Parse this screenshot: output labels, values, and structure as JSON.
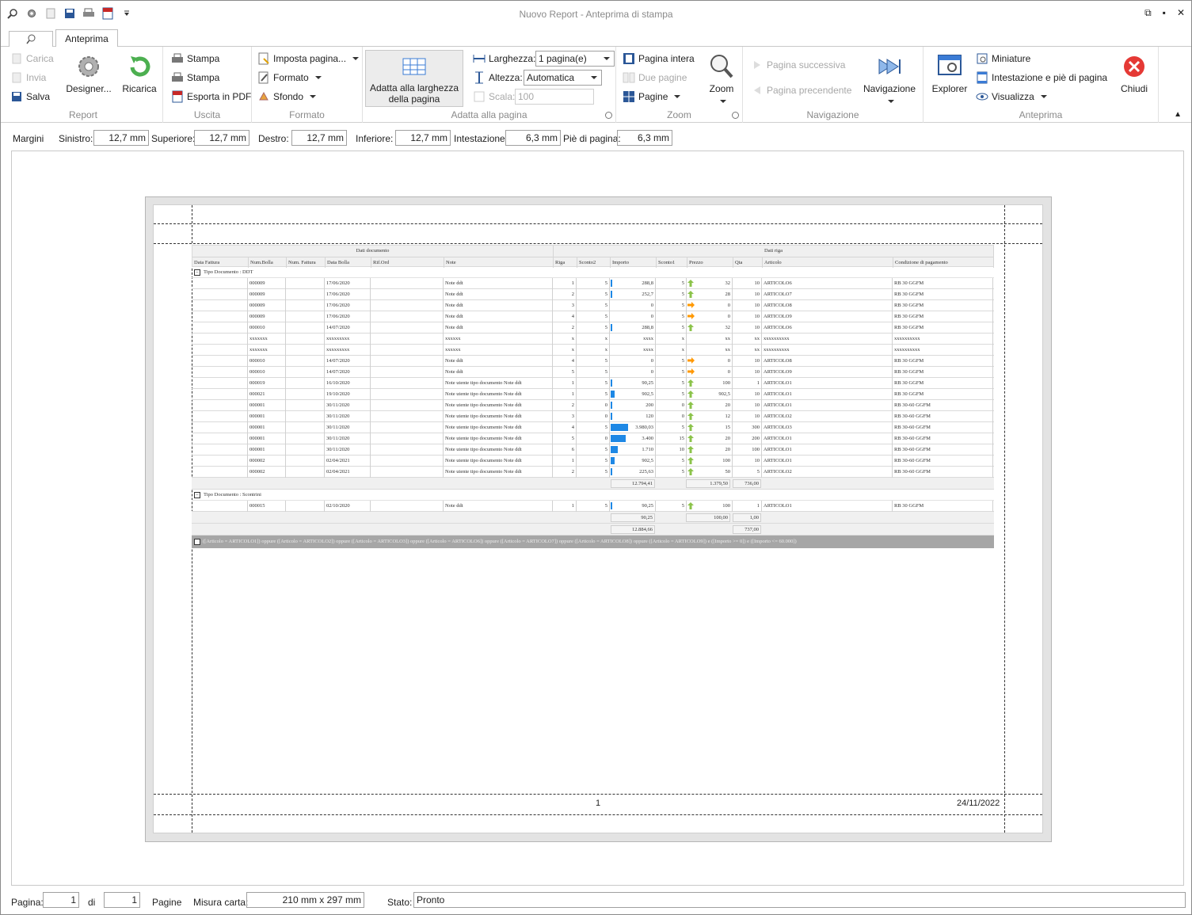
{
  "window": {
    "title": "Nuovo Report - Anteprima di stampa"
  },
  "tabs": {
    "active": "Anteprima"
  },
  "ribbon": {
    "report": {
      "label": "Report",
      "carica": "Carica",
      "invia": "Invia",
      "salva": "Salva",
      "designer": "Designer...",
      "ricarica": "Ricarica"
    },
    "uscita": {
      "label": "Uscita",
      "stampa1": "Stampa",
      "stampa2": "Stampa",
      "esporta": "Esporta in PDF"
    },
    "formato": {
      "label": "Formato",
      "imposta": "Imposta pagina...",
      "formato": "Formato",
      "sfondo": "Sfondo"
    },
    "adatta": {
      "label": "Adatta alla pagina",
      "button_line1": "Adatta alla larghezza",
      "button_line2": "della pagina",
      "larghezza_label": "Larghezza:",
      "larghezza_value": "1 pagina(e)",
      "altezza_label": "Altezza:",
      "altezza_value": "Automatica",
      "scala_label": "Scala:",
      "scala_value": "100"
    },
    "zoom": {
      "label": "Zoom",
      "pagina_intera": "Pagina intera",
      "due_pagine": "Due pagine",
      "pagine": "Pagine",
      "zoom": "Zoom"
    },
    "navigazione": {
      "label": "Navigazione",
      "successiva": "Pagina successiva",
      "precedente": "Pagina precendente",
      "navigazione": "Navigazione"
    },
    "anteprima": {
      "label": "Anteprima",
      "explorer": "Explorer",
      "miniature": "Miniature",
      "intestazione": "Intestazione e piè di pagina",
      "visualizza": "Visualizza",
      "chiudi": "Chiudi"
    }
  },
  "margins": {
    "margini": "Margini",
    "sinistro_label": "Sinistro:",
    "sinistro": "12,7 mm",
    "superiore_label": "Superiore:",
    "superiore": "12,7 mm",
    "destro_label": "Destro:",
    "destro": "12,7 mm",
    "inferiore_label": "Inferiore:",
    "inferiore": "12,7 mm",
    "intestazione_label": "Intestazione",
    "intestazione": "6,3 mm",
    "pie_label": "Piè di pagina:",
    "pie": "6,3 mm"
  },
  "report": {
    "band_left": "Dati documento",
    "band_right": "Dati riga",
    "columns": [
      "Data Fattura",
      "Num.Bolla",
      "Num. Fattura",
      "Data Bolla",
      "Rif.Ord",
      "Note",
      "Riga",
      "Sconto2",
      "Importo",
      "Sconto1",
      "Prezzo",
      "Qta",
      "Articolo",
      "Condizione di pagamento"
    ],
    "group1": "Tipo Documento : DDT",
    "rows1": [
      [
        "",
        "000009",
        "",
        "17/06/2020",
        "",
        "Note ddt",
        "1",
        "5",
        "288,8",
        "5",
        "32",
        "10",
        "ARTICOLO6",
        "RB 30 GGFM"
      ],
      [
        "",
        "000009",
        "",
        "17/06/2020",
        "",
        "Note ddt",
        "2",
        "5",
        "252,7",
        "5",
        "28",
        "10",
        "ARTICOLO7",
        "RB 30 GGFM"
      ],
      [
        "",
        "000009",
        "",
        "17/06/2020",
        "",
        "Note ddt",
        "3",
        "5",
        "0",
        "5",
        "0",
        "10",
        "ARTICOLO8",
        "RB 30 GGFM"
      ],
      [
        "",
        "000009",
        "",
        "17/06/2020",
        "",
        "Note ddt",
        "4",
        "5",
        "0",
        "5",
        "0",
        "10",
        "ARTICOLO9",
        "RB 30 GGFM"
      ],
      [
        "",
        "000010",
        "",
        "14/07/2020",
        "",
        "Note ddt",
        "2",
        "5",
        "288,8",
        "5",
        "32",
        "10",
        "ARTICOLO6",
        "RB 30 GGFM"
      ],
      [
        "",
        "xxxxxxx",
        "",
        "xxxxxxxxx",
        "",
        "xxxxxx",
        "x",
        "x",
        "xxxx",
        "x",
        "xx",
        "xx",
        "xxxxxxxxxx",
        "xxxxxxxxxx"
      ],
      [
        "",
        "xxxxxxx",
        "",
        "xxxxxxxxx",
        "",
        "xxxxxx",
        "x",
        "x",
        "xxxx",
        "x",
        "xx",
        "xx",
        "xxxxxxxxxx",
        "xxxxxxxxxx"
      ],
      [
        "",
        "000010",
        "",
        "14/07/2020",
        "",
        "Note ddt",
        "4",
        "5",
        "0",
        "5",
        "0",
        "10",
        "ARTICOLO8",
        "RB 30 GGFM"
      ],
      [
        "",
        "000010",
        "",
        "14/07/2020",
        "",
        "Note ddt",
        "5",
        "5",
        "0",
        "5",
        "0",
        "10",
        "ARTICOLO9",
        "RB 30 GGFM"
      ],
      [
        "",
        "000019",
        "",
        "16/10/2020",
        "",
        "Note utente tipo documento Note ddt",
        "1",
        "5",
        "90,25",
        "5",
        "100",
        "1",
        "ARTICOLO1",
        "RB 30 GGFM"
      ],
      [
        "",
        "000021",
        "",
        "19/10/2020",
        "",
        "Note utente tipo documento Note ddt",
        "1",
        "5",
        "902,5",
        "5",
        "902,5",
        "10",
        "ARTICOLO1",
        "RB 30 GGFM"
      ],
      [
        "",
        "000001",
        "",
        "30/11/2020",
        "",
        "Note utente tipo documento Note ddt",
        "2",
        "0",
        "200",
        "0",
        "20",
        "10",
        "ARTICOLO1",
        "RB 30-60 GGFM"
      ],
      [
        "",
        "000001",
        "",
        "30/11/2020",
        "",
        "Note utente tipo documento Note ddt",
        "3",
        "0",
        "120",
        "0",
        "12",
        "10",
        "ARTICOLO2",
        "RB 30-60 GGFM"
      ],
      [
        "",
        "000001",
        "",
        "30/11/2020",
        "",
        "Note utente tipo documento Note ddt",
        "4",
        "5",
        "3.980,03",
        "5",
        "15",
        "300",
        "ARTICOLO3",
        "RB 30-60 GGFM"
      ],
      [
        "",
        "000001",
        "",
        "30/11/2020",
        "",
        "Note utente tipo documento Note ddt",
        "5",
        "0",
        "3.400",
        "15",
        "20",
        "200",
        "ARTICOLO1",
        "RB 30-60 GGFM"
      ],
      [
        "",
        "000001",
        "",
        "30/11/2020",
        "",
        "Note utente tipo documento Note ddt",
        "6",
        "5",
        "1.710",
        "10",
        "20",
        "100",
        "ARTICOLO1",
        "RB 30-60 GGFM"
      ],
      [
        "",
        "000002",
        "",
        "02/04/2021",
        "",
        "Note utente tipo documento Note ddt",
        "1",
        "5",
        "902,5",
        "5",
        "100",
        "10",
        "ARTICOLO1",
        "RB 30-60 GGFM"
      ],
      [
        "",
        "000002",
        "",
        "02/04/2021",
        "",
        "Note utente tipo documento Note ddt",
        "2",
        "5",
        "225,63",
        "5",
        "50",
        "5",
        "ARTICOLO2",
        "RB 30-60 GGFM"
      ]
    ],
    "sum1": {
      "importo": "12.794,41",
      "prezzo": "1.379,50",
      "qta": "736,00"
    },
    "group2": "Tipo Documento : Scontrini",
    "rows2": [
      [
        "",
        "000015",
        "",
        "02/10/2020",
        "",
        "Note ddt",
        "1",
        "5",
        "90,25",
        "5",
        "100",
        "1",
        "ARTICOLO1",
        "RB 30 GGFM"
      ]
    ],
    "sum2": {
      "importo": "90,25",
      "prezzo": "100,00",
      "qta": "1,00"
    },
    "total": {
      "importo": "12.884,66",
      "qta": "737,00"
    },
    "filter": "([Articolo = ARTICOLO1]) oppure ([Articolo = ARTICOLO2]) oppure ([Articolo = ARTICOLO3]) oppure ([Articolo = ARTICOLO6]) oppure ([Articolo = ARTICOLO7]) oppure ([Articolo = ARTICOLO8]) oppure ([Articolo = ARTICOLO9]) e ([Importo >= 0]) e ([Importo <= 60.000])",
    "page_number": "1",
    "date": "24/11/2022"
  },
  "status": {
    "pagina_label": "Pagina:",
    "pagina": "1",
    "di": "di",
    "totale": "1",
    "pagine": "Pagine",
    "misura_label": "Misura carta:",
    "misura": "210 mm x 297 mm",
    "stato_label": "Stato:",
    "stato": "Pronto"
  },
  "colors": {
    "accent": "#1e88e5",
    "arrow_up": "#8bc34a",
    "arrow_right": "#ff9800"
  }
}
